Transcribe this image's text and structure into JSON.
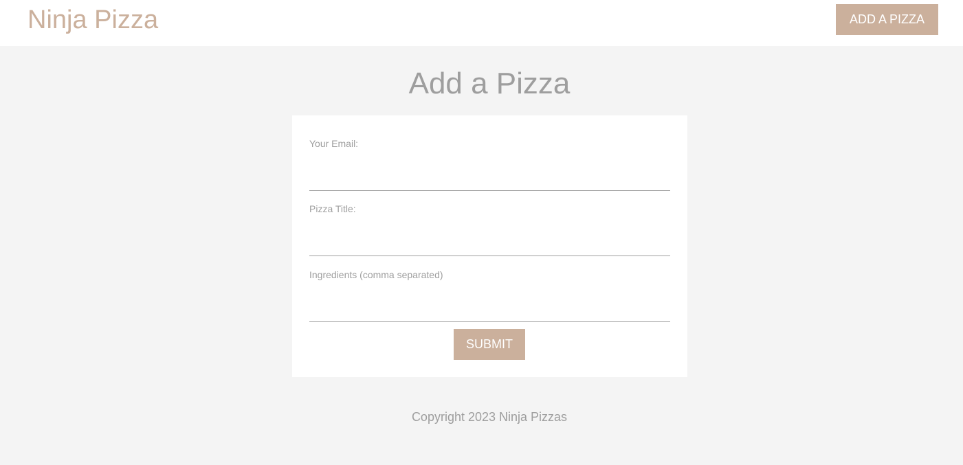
{
  "navbar": {
    "brand": "Ninja Pizza",
    "add_button": "ADD A PIZZA"
  },
  "main": {
    "title": "Add a Pizza"
  },
  "form": {
    "email_label": "Your Email:",
    "email_value": "",
    "title_label": "Pizza Title:",
    "title_value": "",
    "ingredients_label": "Ingredients (comma separated)",
    "ingredients_value": "",
    "submit_label": "SUBMIT"
  },
  "footer": {
    "text": "Copyright 2023 Ninja Pizzas"
  },
  "colors": {
    "brand": "#cbb09c",
    "page_background": "#f4f4f4",
    "text_muted": "#9e9e9e"
  }
}
